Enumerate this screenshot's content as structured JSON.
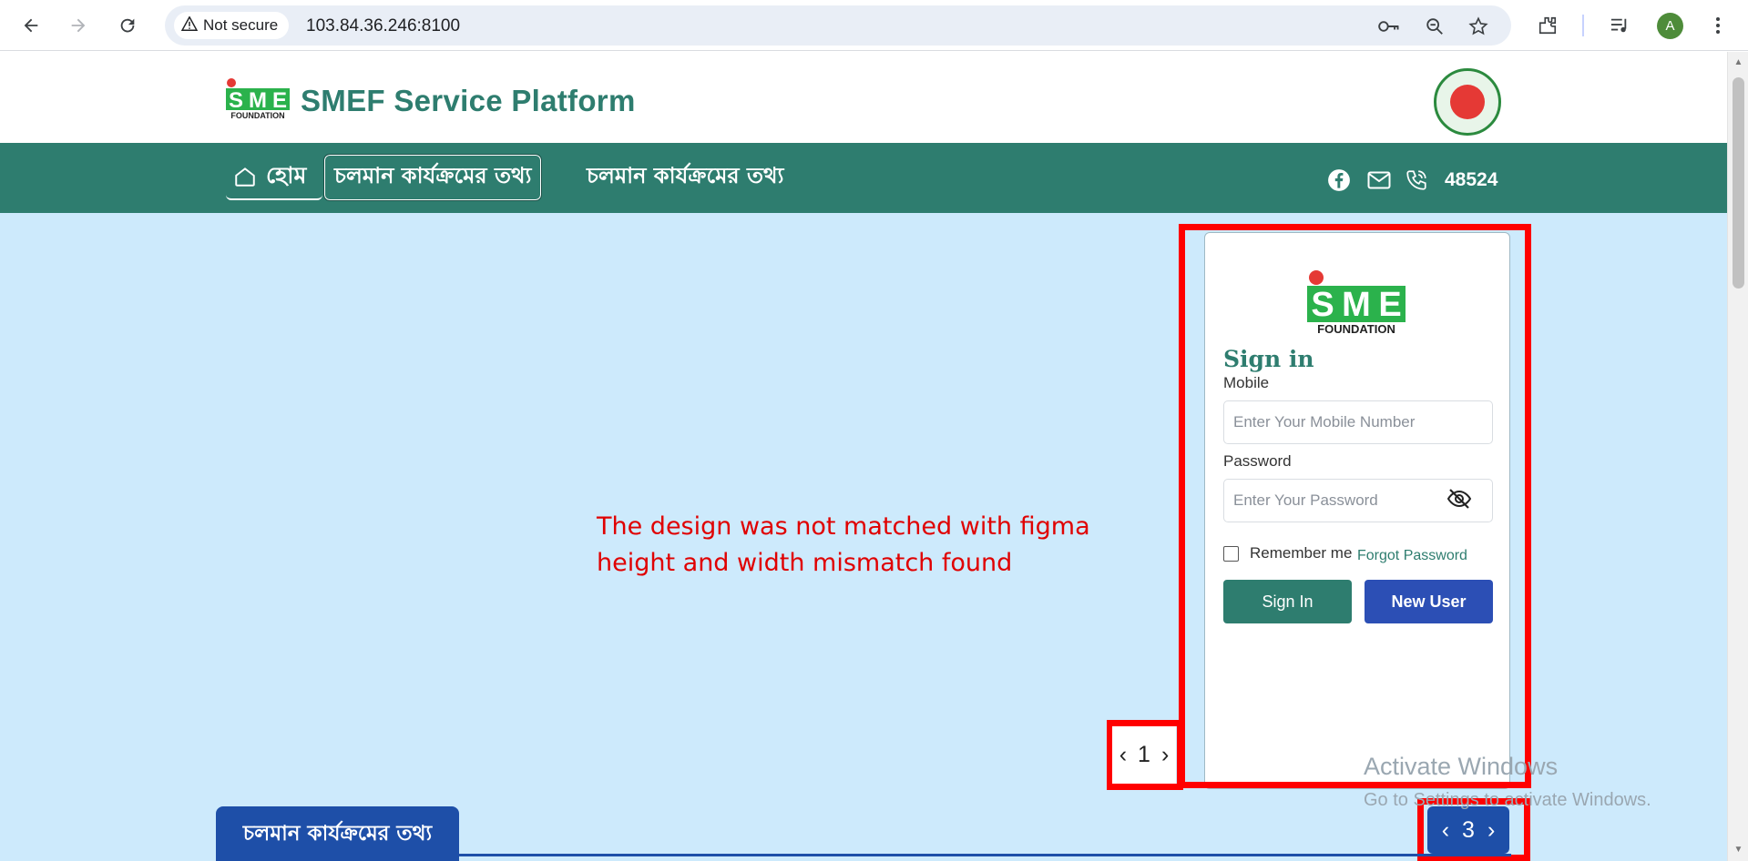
{
  "browser": {
    "security_label": "Not secure",
    "url": "103.84.36.246:8100",
    "avatar_letter": "A",
    "accent_color": "#4e8c3a"
  },
  "site": {
    "title": "SMEF Service Platform",
    "brand_color": "#2e7d6f",
    "logo_letters": [
      "S",
      "M",
      "E"
    ],
    "logo_caption": "FOUNDATION"
  },
  "navbar": {
    "home_label": "হোম",
    "items": [
      {
        "label": "চলমান কার্যক্রমের তথ্য",
        "active": true
      },
      {
        "label": "চলমান কার্যক্রমের তথ্য",
        "active": false
      }
    ],
    "hotline": "48524",
    "icons": [
      "facebook-icon",
      "mail-icon",
      "phone-icon"
    ]
  },
  "annotation": {
    "line1": "The design was not matched with figma",
    "line2": "height and width mismatch found",
    "color": "#e00000"
  },
  "login": {
    "logo_letters": [
      "S",
      "M",
      "E"
    ],
    "logo_caption": "FOUNDATION",
    "title": "Sign in",
    "mobile_label": "Mobile",
    "mobile_placeholder": "Enter Your Mobile Number",
    "password_label": "Password",
    "password_placeholder": "Enter Your Password",
    "remember_label": "Remember me",
    "forgot_label": "Forgot Password",
    "signin_button": "Sign In",
    "new_user_button": "New User"
  },
  "pager_1": {
    "prev": "‹",
    "page": "1",
    "next": "›"
  },
  "pager_2": {
    "prev": "‹",
    "page": "3",
    "next": "›"
  },
  "bottom_tab": {
    "label": "চলমান কার্যক্রমের তথ্য"
  },
  "watermark": {
    "line1": "Activate Windows",
    "line2": "Go to Settings to activate Windows."
  }
}
